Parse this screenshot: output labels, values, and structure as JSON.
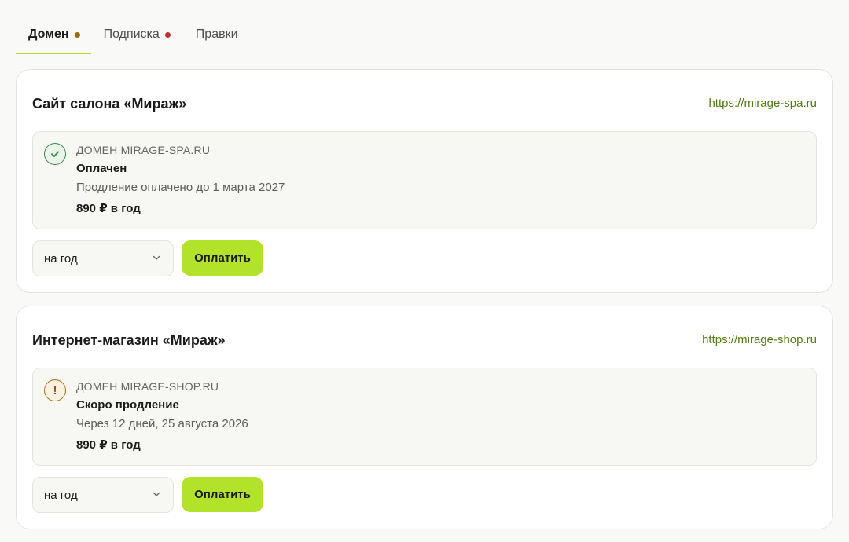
{
  "tabs": [
    {
      "label": "Домен",
      "dot_color": "#9a6b14",
      "active": true
    },
    {
      "label": "Подписка",
      "dot_color": "#c0312b",
      "active": false
    },
    {
      "label": "Правки",
      "dot_color": null,
      "active": false
    }
  ],
  "colors": {
    "accent": "#b3e22b",
    "link": "#4f7a12",
    "ok": "#3f8a4d",
    "warn": "#a86e22"
  },
  "sites": [
    {
      "title": "Сайт салона «Мираж»",
      "url": "https://mirage-spa.ru",
      "status_icon": "check-icon",
      "domain_label": "ДОМЕН MIRAGE-SPA.RU",
      "state": "Оплачен",
      "note": "Продление оплачено до 1 марта 2027",
      "price": "890 ₽ в год",
      "period": "на год",
      "pay_label": "Оплатить"
    },
    {
      "title": "Интернет-магазин «Мираж»",
      "url": "https://mirage-shop.ru",
      "status_icon": "warning-icon",
      "domain_label": "ДОМЕН MIRAGE-SHOP.RU",
      "state": "Скоро продление",
      "note": "Через 12 дней, 25 августа 2026",
      "price": "890 ₽ в год",
      "period": "на год",
      "pay_label": "Оплатить"
    }
  ]
}
